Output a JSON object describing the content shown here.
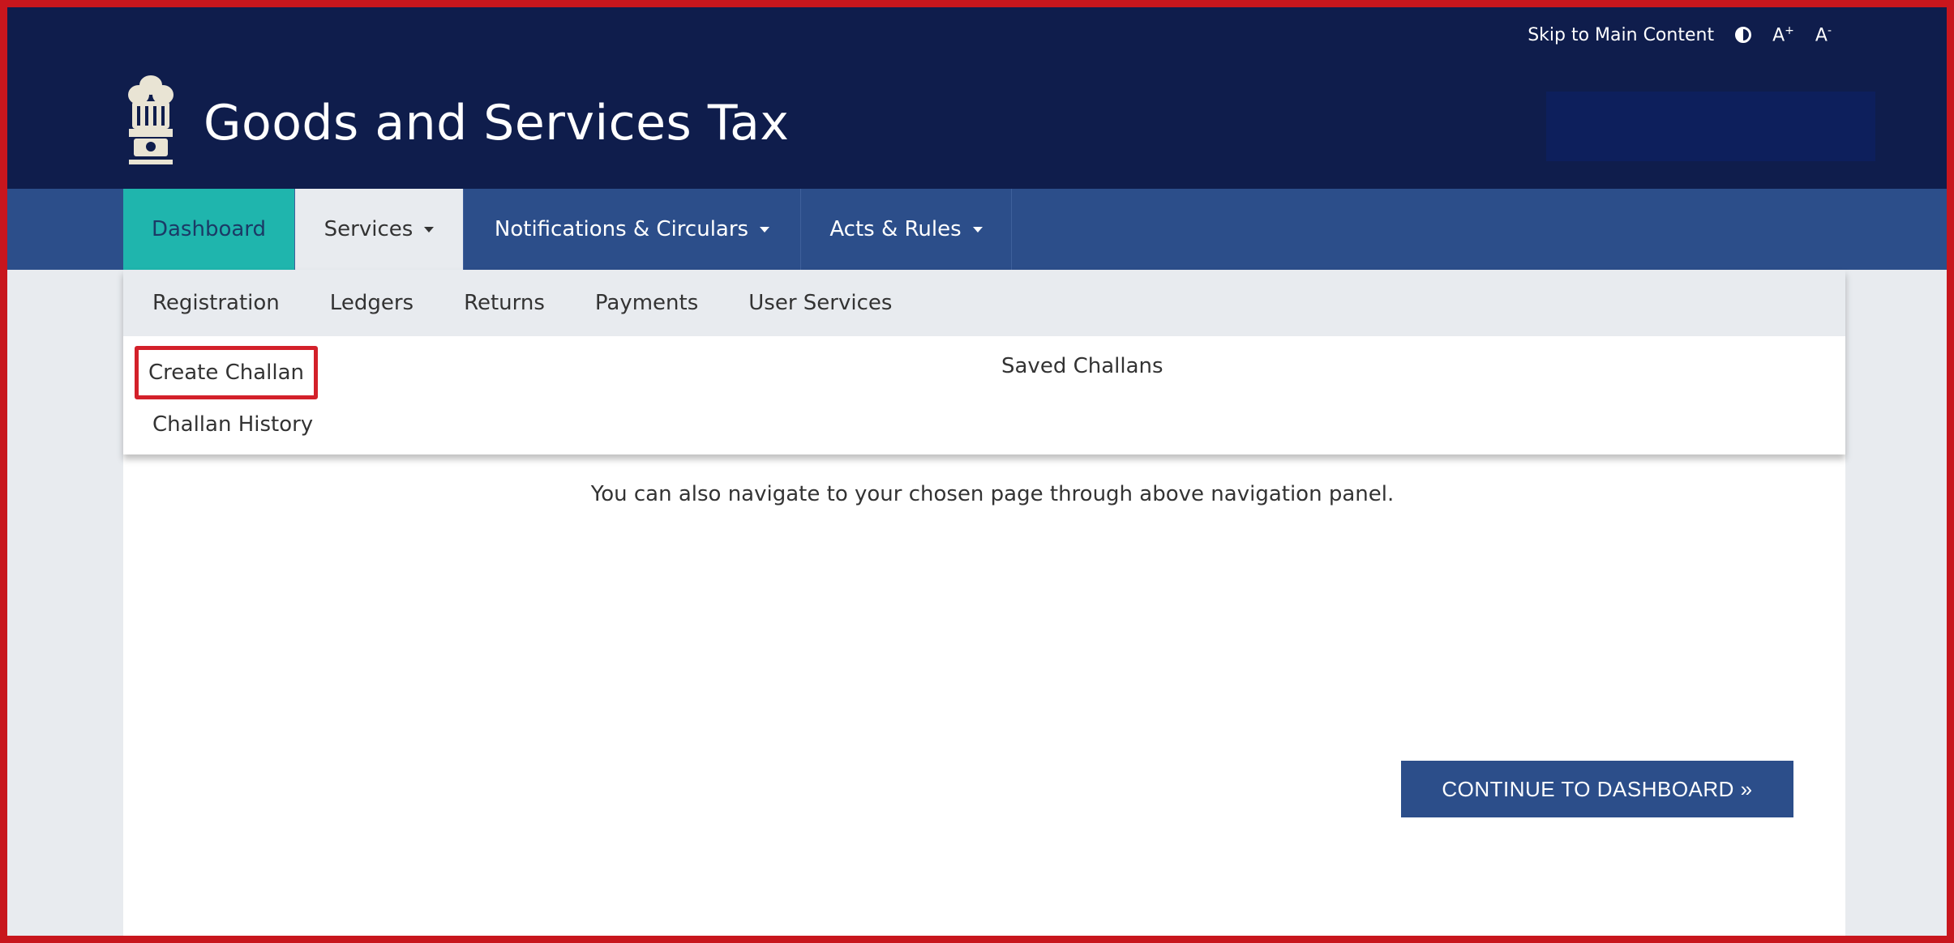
{
  "utility": {
    "skip_link": "Skip to Main Content",
    "font_increase": "A",
    "font_increase_sup": "+",
    "font_decrease": "A",
    "font_decrease_sup": "-"
  },
  "header": {
    "title": "Goods and Services Tax"
  },
  "nav": {
    "dashboard": "Dashboard",
    "services": "Services",
    "notifications": "Notifications & Circulars",
    "acts": "Acts & Rules"
  },
  "subnav": {
    "registration": "Registration",
    "ledgers": "Ledgers",
    "returns": "Returns",
    "payments": "Payments",
    "user_services": "User Services"
  },
  "payments_menu": {
    "create_challan": "Create Challan",
    "saved_challans": "Saved Challans",
    "challan_history": "Challan History"
  },
  "main": {
    "info_text": "You can also navigate to your chosen page through above navigation panel.",
    "continue_button": "CONTINUE TO DASHBOARD »"
  },
  "colors": {
    "header_bg": "#0f1d4c",
    "nav_bg": "#2c4e8a",
    "active_tab": "#1fb5ad",
    "highlight_border": "#d3202a"
  }
}
